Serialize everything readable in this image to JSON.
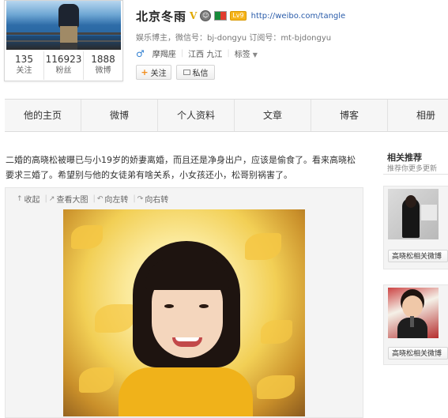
{
  "profile": {
    "name": "北京冬雨",
    "v_badge": "V",
    "level_badge": "Lv9",
    "url": "http://weibo.com/tangle",
    "info": "娱乐博主，微信号：bj-dongyu 订阅号：mt-bjdongyu",
    "gender_symbol": "♂",
    "zodiac": "摩羯座",
    "location": "江西 九江",
    "tags_label": "标签",
    "stats": [
      {
        "num": "135",
        "label": "关注"
      },
      {
        "num": "116923",
        "label": "粉丝"
      },
      {
        "num": "1888",
        "label": "微博"
      }
    ],
    "follow_label": "关注",
    "message_label": "私信"
  },
  "tabs": [
    "他的主页",
    "微博",
    "个人资料",
    "文章",
    "博客",
    "相册"
  ],
  "post": {
    "text": "二婚的高晓松被曝已与小19岁的娇妻离婚，而且还是净身出户，应该是偷食了。看来高晓松要求三婚了。希望别与他的女徒弟有啥关系，小女孩还小，松哥别祸害了。",
    "toolbar": {
      "collapse": "收起",
      "view_large": "查看大图",
      "rotate_left": "向左转",
      "rotate_right": "向右转"
    }
  },
  "related": {
    "title": "相关推荐",
    "subtitle": "推荐你更多更新",
    "cards": [
      {
        "button": "高晓松相关微博"
      },
      {
        "button": "高晓松相关微博"
      }
    ]
  },
  "colors": {
    "accent_link": "#2a5caa",
    "follow_plus": "#f28d1a",
    "male_icon": "#2f7fd1"
  }
}
